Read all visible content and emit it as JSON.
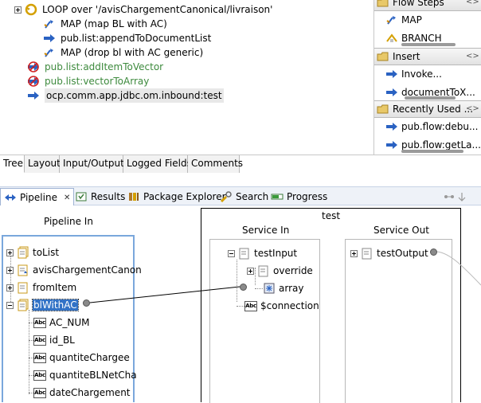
{
  "flow_tree": {
    "items": [
      {
        "label": "LOOP over '/avisChargementCanonical/livraison'",
        "icon": "loop-icon"
      },
      {
        "label": "MAP (map BL with AC)",
        "icon": "map-icon"
      },
      {
        "label": "pub.list:appendToDocumentList",
        "icon": "invoke-icon"
      },
      {
        "label": "MAP (drop bl with AC generic)",
        "icon": "map-icon"
      },
      {
        "label": "pub.list:addItemToVector",
        "icon": "disabled-invoke-icon"
      },
      {
        "label": "pub.list:vectorToArray",
        "icon": "disabled-invoke-icon"
      },
      {
        "label": "ocp.comm.app.jdbc.om.inbound:test",
        "icon": "invoke-icon"
      }
    ]
  },
  "palette": {
    "flow_steps": {
      "title": "Flow Steps",
      "items": [
        "MAP",
        "BRANCH"
      ]
    },
    "insert": {
      "title": "Insert",
      "items": [
        "Invoke...",
        "documentToX..."
      ]
    },
    "recently_used": {
      "title": "Recently Used ...",
      "items": [
        "pub.flow:debu...",
        "pub.flow:getLa..."
      ]
    },
    "collapse_glyph": "<>"
  },
  "sub_tabs": [
    "Tree",
    "Layout",
    "Input/Output",
    "Logged Fields",
    "Comments"
  ],
  "view_tabs": {
    "pipeline": "Pipeline",
    "close_glyph": "✕",
    "results": "Results",
    "package_explorer": "Package Explorer",
    "search": "Search",
    "progress": "Progress"
  },
  "pipeline": {
    "pipeline_in_title": "Pipeline In",
    "service_title": "test",
    "service_in_title": "Service In",
    "service_out_title": "Service Out",
    "pipeline_in": [
      "toList",
      "avisChargementCanon",
      "fromItem",
      "blWithAC",
      "AC_NUM",
      "id_BL",
      "quantiteChargee",
      "quantiteBLNetCha",
      "dateChargement"
    ],
    "service_in": [
      "testInput",
      "override",
      "array",
      "$connectionI"
    ],
    "service_out": [
      "testOutput"
    ],
    "abc_glyph": "Abc"
  },
  "colors": {
    "selection": "#3272c6",
    "disabled_text": "#3d8a3d",
    "map_connector": "#000000"
  }
}
